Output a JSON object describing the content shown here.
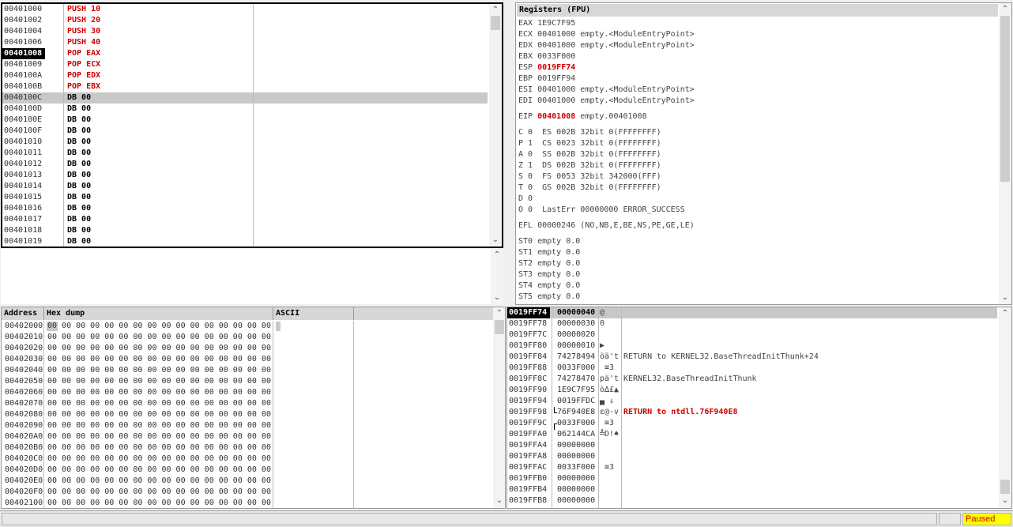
{
  "disasm": {
    "rows": [
      {
        "addr": "00401000",
        "code": "PUSH 10",
        "style": "red"
      },
      {
        "addr": "00401002",
        "code": "PUSH 20",
        "style": "red"
      },
      {
        "addr": "00401004",
        "code": "PUSH 30",
        "style": "red"
      },
      {
        "addr": "00401006",
        "code": "PUSH 40",
        "style": "red"
      },
      {
        "addr": "00401008",
        "code": "POP EAX",
        "style": "red",
        "current": true
      },
      {
        "addr": "00401009",
        "code": "POP ECX",
        "style": "red"
      },
      {
        "addr": "0040100A",
        "code": "POP EDX",
        "style": "red"
      },
      {
        "addr": "0040100B",
        "code": "POP EBX",
        "style": "red"
      },
      {
        "addr": "0040100C",
        "code": "DB 00",
        "style": "plain",
        "highlight": true
      },
      {
        "addr": "0040100D",
        "code": "DB 00",
        "style": "plain"
      },
      {
        "addr": "0040100E",
        "code": "DB 00",
        "style": "plain"
      },
      {
        "addr": "0040100F",
        "code": "DB 00",
        "style": "plain"
      },
      {
        "addr": "00401010",
        "code": "DB 00",
        "style": "plain"
      },
      {
        "addr": "00401011",
        "code": "DB 00",
        "style": "plain"
      },
      {
        "addr": "00401012",
        "code": "DB 00",
        "style": "plain"
      },
      {
        "addr": "00401013",
        "code": "DB 00",
        "style": "plain"
      },
      {
        "addr": "00401014",
        "code": "DB 00",
        "style": "plain"
      },
      {
        "addr": "00401015",
        "code": "DB 00",
        "style": "plain"
      },
      {
        "addr": "00401016",
        "code": "DB 00",
        "style": "plain"
      },
      {
        "addr": "00401017",
        "code": "DB 00",
        "style": "plain"
      },
      {
        "addr": "00401018",
        "code": "DB 00",
        "style": "plain"
      },
      {
        "addr": "00401019",
        "code": "DB 00",
        "style": "plain"
      }
    ]
  },
  "registers": {
    "title": "Registers (FPU)",
    "lines": [
      {
        "name": "EAX",
        "value": "1E9C7F95",
        "comment": ""
      },
      {
        "name": "ECX",
        "value": "00401000",
        "comment": "empty.<ModuleEntryPoint>"
      },
      {
        "name": "EDX",
        "value": "00401000",
        "comment": "empty.<ModuleEntryPoint>"
      },
      {
        "name": "EBX",
        "value": "0033F000",
        "comment": ""
      },
      {
        "name": "ESP",
        "value": "0019FF74",
        "comment": "",
        "changed": true
      },
      {
        "name": "EBP",
        "value": "0019FF94",
        "comment": ""
      },
      {
        "name": "ESI",
        "value": "00401000",
        "comment": "empty.<ModuleEntryPoint>"
      },
      {
        "name": "EDI",
        "value": "00401000",
        "comment": "empty.<ModuleEntryPoint>"
      },
      {
        "name": "EIP",
        "value": "00401008",
        "comment": "empty.00401008",
        "changed": true,
        "gap": true
      },
      {
        "name": "C 0",
        "value": "ES 002B 32bit 0(FFFFFFFF)",
        "comment": "",
        "gap": true,
        "flag": true
      },
      {
        "name": "P 1",
        "value": "CS 0023 32bit 0(FFFFFFFF)",
        "comment": "",
        "flag": true
      },
      {
        "name": "A 0",
        "value": "SS 002B 32bit 0(FFFFFFFF)",
        "comment": "",
        "flag": true
      },
      {
        "name": "Z 1",
        "value": "DS 002B 32bit 0(FFFFFFFF)",
        "comment": "",
        "flag": true
      },
      {
        "name": "S 0",
        "value": "FS 0053 32bit 342000(FFF)",
        "comment": "",
        "flag": true
      },
      {
        "name": "T 0",
        "value": "GS 002B 32bit 0(FFFFFFFF)",
        "comment": "",
        "flag": true
      },
      {
        "name": "D 0",
        "value": "",
        "comment": "",
        "flag": true
      },
      {
        "name": "O 0",
        "value": "LastErr 00000000 ERROR_SUCCESS",
        "comment": "",
        "flag": true
      },
      {
        "name": "EFL",
        "value": "00000246",
        "comment": "(NO,NB,E,BE,NS,PE,GE,LE)",
        "gap": true
      },
      {
        "name": "ST0",
        "value": "empty",
        "comment": "0.0",
        "gap": true
      },
      {
        "name": "ST1",
        "value": "empty",
        "comment": "0.0"
      },
      {
        "name": "ST2",
        "value": "empty",
        "comment": "0.0"
      },
      {
        "name": "ST3",
        "value": "empty",
        "comment": "0.0"
      },
      {
        "name": "ST4",
        "value": "empty",
        "comment": "0.0"
      },
      {
        "name": "ST5",
        "value": "empty",
        "comment": "0.0"
      }
    ]
  },
  "dump": {
    "headers": {
      "address": "Address",
      "hex": "Hex dump",
      "ascii": "ASCII"
    },
    "rows": [
      {
        "addr": "00402000",
        "hex": "00 00 00 00 00 00 00 00 00 00 00 00 00 00 00 00"
      },
      {
        "addr": "00402010",
        "hex": "00 00 00 00 00 00 00 00 00 00 00 00 00 00 00 00"
      },
      {
        "addr": "00402020",
        "hex": "00 00 00 00 00 00 00 00 00 00 00 00 00 00 00 00"
      },
      {
        "addr": "00402030",
        "hex": "00 00 00 00 00 00 00 00 00 00 00 00 00 00 00 00"
      },
      {
        "addr": "00402040",
        "hex": "00 00 00 00 00 00 00 00 00 00 00 00 00 00 00 00"
      },
      {
        "addr": "00402050",
        "hex": "00 00 00 00 00 00 00 00 00 00 00 00 00 00 00 00"
      },
      {
        "addr": "00402060",
        "hex": "00 00 00 00 00 00 00 00 00 00 00 00 00 00 00 00"
      },
      {
        "addr": "00402070",
        "hex": "00 00 00 00 00 00 00 00 00 00 00 00 00 00 00 00"
      },
      {
        "addr": "00402080",
        "hex": "00 00 00 00 00 00 00 00 00 00 00 00 00 00 00 00"
      },
      {
        "addr": "00402090",
        "hex": "00 00 00 00 00 00 00 00 00 00 00 00 00 00 00 00"
      },
      {
        "addr": "004020A0",
        "hex": "00 00 00 00 00 00 00 00 00 00 00 00 00 00 00 00"
      },
      {
        "addr": "004020B0",
        "hex": "00 00 00 00 00 00 00 00 00 00 00 00 00 00 00 00"
      },
      {
        "addr": "004020C0",
        "hex": "00 00 00 00 00 00 00 00 00 00 00 00 00 00 00 00"
      },
      {
        "addr": "004020D0",
        "hex": "00 00 00 00 00 00 00 00 00 00 00 00 00 00 00 00"
      },
      {
        "addr": "004020E0",
        "hex": "00 00 00 00 00 00 00 00 00 00 00 00 00 00 00 00"
      },
      {
        "addr": "004020F0",
        "hex": "00 00 00 00 00 00 00 00 00 00 00 00 00 00 00 00"
      },
      {
        "addr": "00402100",
        "hex": "00 00 00 00 00 00 00 00 00 00 00 00 00 00 00 00"
      }
    ]
  },
  "stack": {
    "rows": [
      {
        "addr": "0019FF74",
        "value": "00000040",
        "ascii": "@",
        "comment": "",
        "top": true
      },
      {
        "addr": "0019FF78",
        "value": "00000030",
        "ascii": "0",
        "comment": ""
      },
      {
        "addr": "0019FF7C",
        "value": "00000020",
        "ascii": "",
        "comment": ""
      },
      {
        "addr": "0019FF80",
        "value": "00000010",
        "ascii": "▶",
        "comment": ""
      },
      {
        "addr": "0019FF84",
        "value": "74278494",
        "ascii": "öä't",
        "comment": "RETURN to KERNEL32.BaseThreadInitThunk+24"
      },
      {
        "addr": "0019FF88",
        "value": "0033F000",
        "ascii": " ≡3",
        "comment": ""
      },
      {
        "addr": "0019FF8C",
        "value": "74278470",
        "ascii": "pä't",
        "comment": "KERNEL32.BaseThreadInitThunk"
      },
      {
        "addr": "0019FF90",
        "value": "1E9C7F95",
        "ascii": "ò∆£▲",
        "comment": ""
      },
      {
        "addr": "0019FF94",
        "value": "0019FFDC",
        "ascii": "▄ ↓",
        "comment": ""
      },
      {
        "addr": "0019FF98",
        "value": "76F940E8",
        "ascii": "ε@·v",
        "comment": "RETURN to ntdll.76F940E8",
        "red": true,
        "bracket": "end"
      },
      {
        "addr": "0019FF9C",
        "value": "0033F000",
        "ascii": " ≡3",
        "comment": "",
        "bracket": "start"
      },
      {
        "addr": "0019FFA0",
        "value": "062144CA",
        "ascii": "╩D!♠",
        "comment": ""
      },
      {
        "addr": "0019FFA4",
        "value": "00000000",
        "ascii": "",
        "comment": ""
      },
      {
        "addr": "0019FFA8",
        "value": "00000000",
        "ascii": "",
        "comment": ""
      },
      {
        "addr": "0019FFAC",
        "value": "0033F000",
        "ascii": " ≡3",
        "comment": ""
      },
      {
        "addr": "0019FFB0",
        "value": "00000000",
        "ascii": "",
        "comment": ""
      },
      {
        "addr": "0019FFB4",
        "value": "00000000",
        "ascii": "",
        "comment": ""
      },
      {
        "addr": "0019FFB8",
        "value": "00000000",
        "ascii": "",
        "comment": ""
      }
    ]
  },
  "status": {
    "state": "Paused"
  },
  "colors": {
    "accent_red": "#d00000",
    "paused_bg": "#ffff00",
    "header_bg": "#d7d7d7",
    "highlight_row": "#c8c8c8"
  },
  "icons": {
    "scroll_up": "chevron-up-icon",
    "scroll_down": "chevron-down-icon"
  }
}
